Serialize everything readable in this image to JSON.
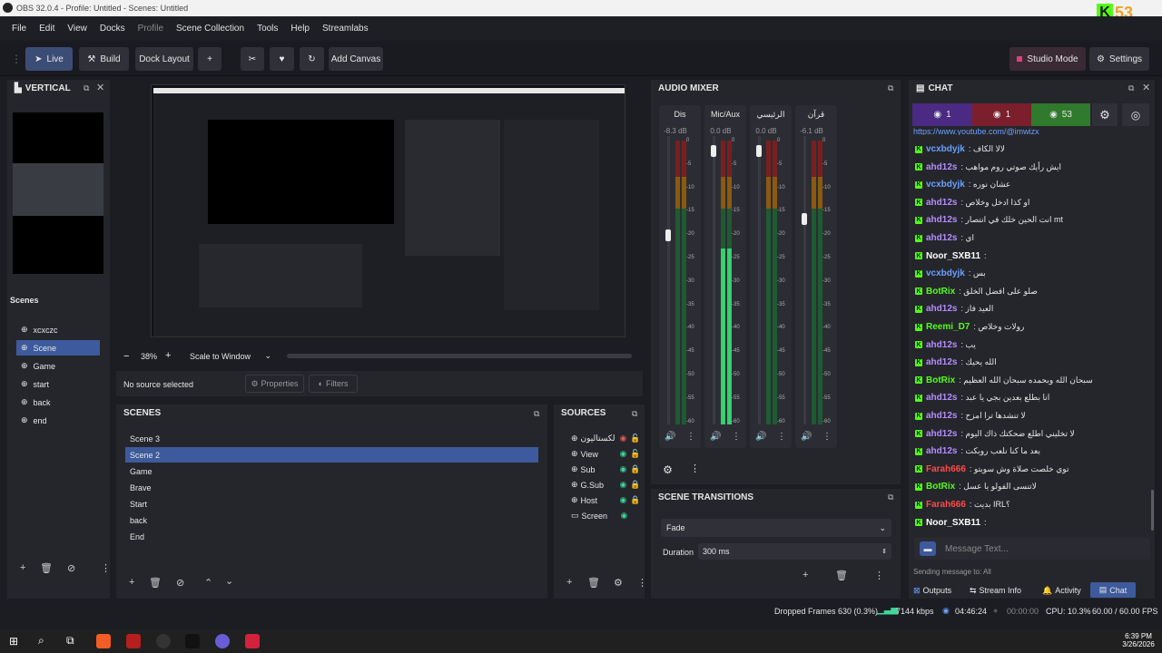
{
  "window": {
    "title": "OBS 32.0.4 - Profile: Untitled - Scenes: Untitled",
    "kick_count": "53"
  },
  "menu": [
    "File",
    "Edit",
    "View",
    "Docks",
    "Profile",
    "Scene Collection",
    "Tools",
    "Help",
    "Streamlabs"
  ],
  "toolbar": {
    "live": "Live",
    "build": "Build",
    "dock_layout": "Dock Layout",
    "plus": "+",
    "add_canvas": "Add Canvas",
    "studio_mode": "Studio Mode",
    "settings": "Settings"
  },
  "vertical": {
    "title": "VERTICAL",
    "scenes_label": "Scenes",
    "scenes": [
      "xcxczc",
      "Scene",
      "Game",
      "start",
      "back",
      "end"
    ],
    "selected": 1
  },
  "preview": {
    "zoom": "38%",
    "scale": "Scale to Window",
    "no_source": "No source selected",
    "properties": "Properties",
    "filters": "Filters",
    "minus": "−",
    "plus": "+"
  },
  "scenes": {
    "title": "SCENES",
    "items": [
      "Scene 3",
      "Scene 2",
      "Game",
      "Brave",
      "Start",
      "back",
      "End"
    ],
    "selected": 1
  },
  "sources": {
    "title": "SOURCES",
    "items": [
      "لكستاليون",
      "View",
      "Sub",
      "G.Sub",
      "Host",
      "Screen"
    ]
  },
  "audio_mixer": {
    "title": "AUDIO MIXER",
    "channels": [
      {
        "name": "Dis",
        "db": "-8.3 dB",
        "level": 0.0
      },
      {
        "name": "Mic/Aux",
        "db": "0.0 dB",
        "level": 0.62
      },
      {
        "name": "الرئيسي",
        "db": "0.0 dB",
        "level": 0.0
      },
      {
        "name": "قرآن",
        "db": "-6.1 dB",
        "level": 0.0
      }
    ],
    "scale": [
      "0",
      "-5",
      "-10",
      "-15",
      "-20",
      "-25",
      "-30",
      "-35",
      "-40",
      "-45",
      "-50",
      "-55",
      "-60"
    ]
  },
  "transitions": {
    "title": "SCENE TRANSITIONS",
    "type": "Fade",
    "duration_label": "Duration",
    "duration": "300 ms"
  },
  "chat": {
    "title": "CHAT",
    "counts": [
      "1",
      "1",
      "53"
    ],
    "url": "https://www.youtube.com/@imwizx",
    "placeholder": "Message Text...",
    "sending": "Sending message to: All",
    "tabs": [
      "Outputs",
      "Stream Info",
      "Activity",
      "Chat"
    ],
    "messages": [
      {
        "user": "vcxbdyjk",
        "color": "#6aa0ff",
        "text": ": لالا الكاف"
      },
      {
        "user": "ahd12s",
        "color": "#b58cff",
        "text": ": ايش رأيك صوتي روم مواهب"
      },
      {
        "user": "vcxbdyjk",
        "color": "#6aa0ff",
        "text": ": عشان نوره"
      },
      {
        "user": "ahd12s",
        "color": "#b58cff",
        "text": ": او كذا ادخل وخلاص"
      },
      {
        "user": "ahd12s",
        "color": "#b58cff",
        "text": ": انت الحين خلك في انتصار mt"
      },
      {
        "user": "ahd12s",
        "color": "#b58cff",
        "text": ": اي"
      },
      {
        "user": "Noor_SXB11",
        "color": "#ffffff",
        "text": ":"
      },
      {
        "user": "vcxbdyjk",
        "color": "#6aa0ff",
        "text": ": بس"
      },
      {
        "user": "BotRix",
        "color": "#53fc18",
        "text": ": صلو على افضل الخلق"
      },
      {
        "user": "ahd12s",
        "color": "#b58cff",
        "text": ": العيد فاز"
      },
      {
        "user": "Reemi_D7",
        "color": "#53fc18",
        "text": ": رولات وخلاص"
      },
      {
        "user": "ahd12s",
        "color": "#b58cff",
        "text": ": يب"
      },
      {
        "user": "ahd12s",
        "color": "#b58cff",
        "text": ": الله يحيك"
      },
      {
        "user": "BotRix",
        "color": "#53fc18",
        "text": ": سبحان الله وبحمده سبحان الله العظيم"
      },
      {
        "user": "ahd12s",
        "color": "#b58cff",
        "text": ": انا بطلع بعدين بجي يا عبد"
      },
      {
        "user": "ahd12s",
        "color": "#b58cff",
        "text": ": لا تنشدها ترا امزح"
      },
      {
        "user": "ahd12s",
        "color": "#b58cff",
        "text": ": لا تخليني اطلع ضحكتك ذاك اليوم"
      },
      {
        "user": "ahd12s",
        "color": "#b58cff",
        "text": ": بعد ما كنا نلعب روبكت"
      },
      {
        "user": "Farah666",
        "color": "#ff4a4a",
        "text": ": توي خلصت صلاة وش سويتو"
      },
      {
        "user": "BotRix",
        "color": "#53fc18",
        "text": ": لاتنسى الفولو يا عسل"
      },
      {
        "user": "Farah666",
        "color": "#ff4a4a",
        "text": ": بديت IRL؟"
      },
      {
        "user": "Noor_SXB11",
        "color": "#ffffff",
        "text": ":"
      }
    ]
  },
  "status": {
    "dropped": "Dropped Frames 630 (0.3%)",
    "kbps": "7144 kbps",
    "live_time": "04:46:24",
    "rec_time": "00:00:00",
    "cpu": "CPU: 10.3%",
    "fps": "60.00 / 60.00 FPS"
  },
  "taskbar": {
    "time": "6:39 PM",
    "date": "3/26/2026"
  }
}
